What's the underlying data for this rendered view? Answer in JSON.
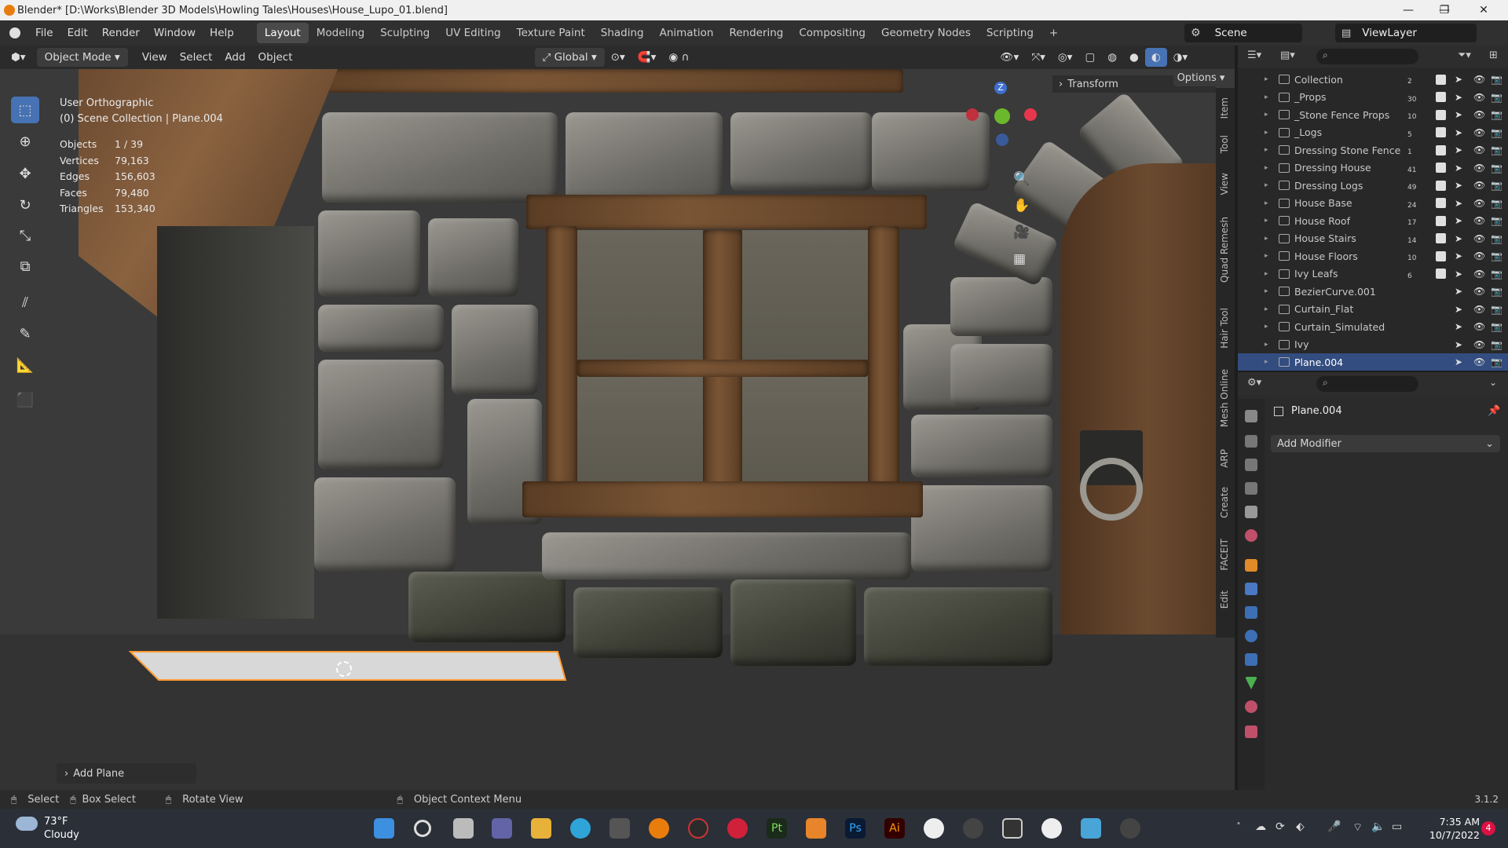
{
  "window": {
    "title": "Blender* [D:\\Works\\Blender 3D Models\\Howling Tales\\Houses\\House_Lupo_01.blend]",
    "minimize": "—",
    "maximize": "❐",
    "close": "✕"
  },
  "menu": {
    "items": [
      "File",
      "Edit",
      "Render",
      "Window",
      "Help"
    ],
    "workspaces": [
      "Layout",
      "Modeling",
      "Sculpting",
      "UV Editing",
      "Texture Paint",
      "Shading",
      "Animation",
      "Rendering",
      "Compositing",
      "Geometry Nodes",
      "Scripting"
    ],
    "add_workspace": "+",
    "scene": "Scene",
    "view_layer": "ViewLayer"
  },
  "viewport_header": {
    "mode": "Object Mode",
    "view": "View",
    "select": "Select",
    "add": "Add",
    "object": "Object",
    "orientation": "Global",
    "options": "Options"
  },
  "viewport": {
    "view_name": "User Orthographic",
    "collection_info": "(0) Scene Collection | Plane.004",
    "stats": [
      {
        "label": "Objects",
        "value": "1 / 39"
      },
      {
        "label": "Vertices",
        "value": "79,163"
      },
      {
        "label": "Edges",
        "value": "156,603"
      },
      {
        "label": "Faces",
        "value": "79,480"
      },
      {
        "label": "Triangles",
        "value": "153,340"
      }
    ],
    "transform_panel": "Transform",
    "last_operator": "Add Plane",
    "sidebar_tabs": [
      "Item",
      "Tool",
      "View",
      "Quad Remesh",
      "Hair Tool",
      "Mesh Online",
      "ARP",
      "Create",
      "FACEIT",
      "Edit"
    ],
    "gizmo_z": "Z"
  },
  "outliner": {
    "rows": [
      {
        "label": "Collection",
        "count": "2",
        "selected": false
      },
      {
        "label": "_Props",
        "count": "30",
        "selected": false
      },
      {
        "label": "_Stone Fence Props",
        "count": "10",
        "selected": false
      },
      {
        "label": "_Logs",
        "count": "5",
        "selected": false
      },
      {
        "label": "Dressing Stone Fence",
        "count": "1",
        "selected": false
      },
      {
        "label": "Dressing House",
        "count": "41",
        "selected": false
      },
      {
        "label": "Dressing Logs",
        "count": "49",
        "selected": false
      },
      {
        "label": "House Base",
        "count": "24",
        "selected": false
      },
      {
        "label": "House Roof",
        "count": "17",
        "selected": false
      },
      {
        "label": "House Stairs",
        "count": "14",
        "selected": false
      },
      {
        "label": "House Floors",
        "count": "10",
        "selected": false
      },
      {
        "label": "Ivy Leafs",
        "count": "6",
        "selected": false
      },
      {
        "label": "BezierCurve.001",
        "count": "",
        "selected": false
      },
      {
        "label": "Curtain_Flat",
        "count": "",
        "selected": false
      },
      {
        "label": "Curtain_Simulated",
        "count": "",
        "selected": false
      },
      {
        "label": "Ivy",
        "count": "",
        "selected": false
      },
      {
        "label": "Plane.004",
        "count": "",
        "selected": true
      }
    ]
  },
  "properties": {
    "object_name": "Plane.004",
    "add_modifier": "Add Modifier"
  },
  "statusbar": {
    "select": "Select",
    "box_select": "Box Select",
    "rotate_view": "Rotate View",
    "context_menu": "Object Context Menu",
    "version": "3.1.2"
  },
  "taskbar": {
    "temperature": "73°F",
    "weather": "Cloudy",
    "time": "7:35 AM",
    "date": "10/7/2022",
    "notification_count": "4"
  }
}
